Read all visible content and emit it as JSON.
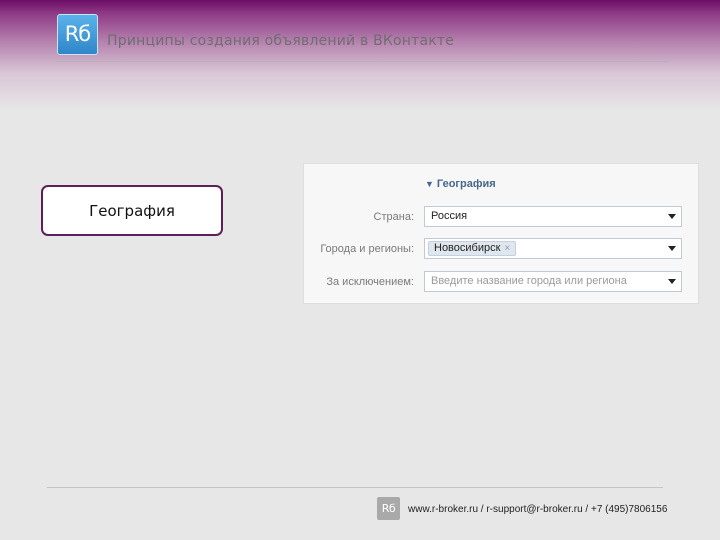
{
  "header": {
    "logo_text": "Rб",
    "title": "Принципы создания объявлений в ВКонтакте"
  },
  "topic": {
    "label": "География"
  },
  "geo_panel": {
    "section_header": "География",
    "country": {
      "label": "Страна:",
      "value": "Россия"
    },
    "cities": {
      "label": "Города и регионы:",
      "token": "Новосибирск",
      "remove_glyph": "×"
    },
    "exclusions": {
      "label": "За исключением:",
      "placeholder": "Введите название города или региона"
    }
  },
  "footer": {
    "logo_text": "Rб",
    "contact": "www.r-broker.ru / r-support@r-broker.ru / +7 (495)7806156"
  },
  "colors": {
    "header_purple": "#6d0d67",
    "topic_border": "#5e1f5a",
    "section_blue": "#45688e",
    "logo_blue": "#2f86c9"
  }
}
